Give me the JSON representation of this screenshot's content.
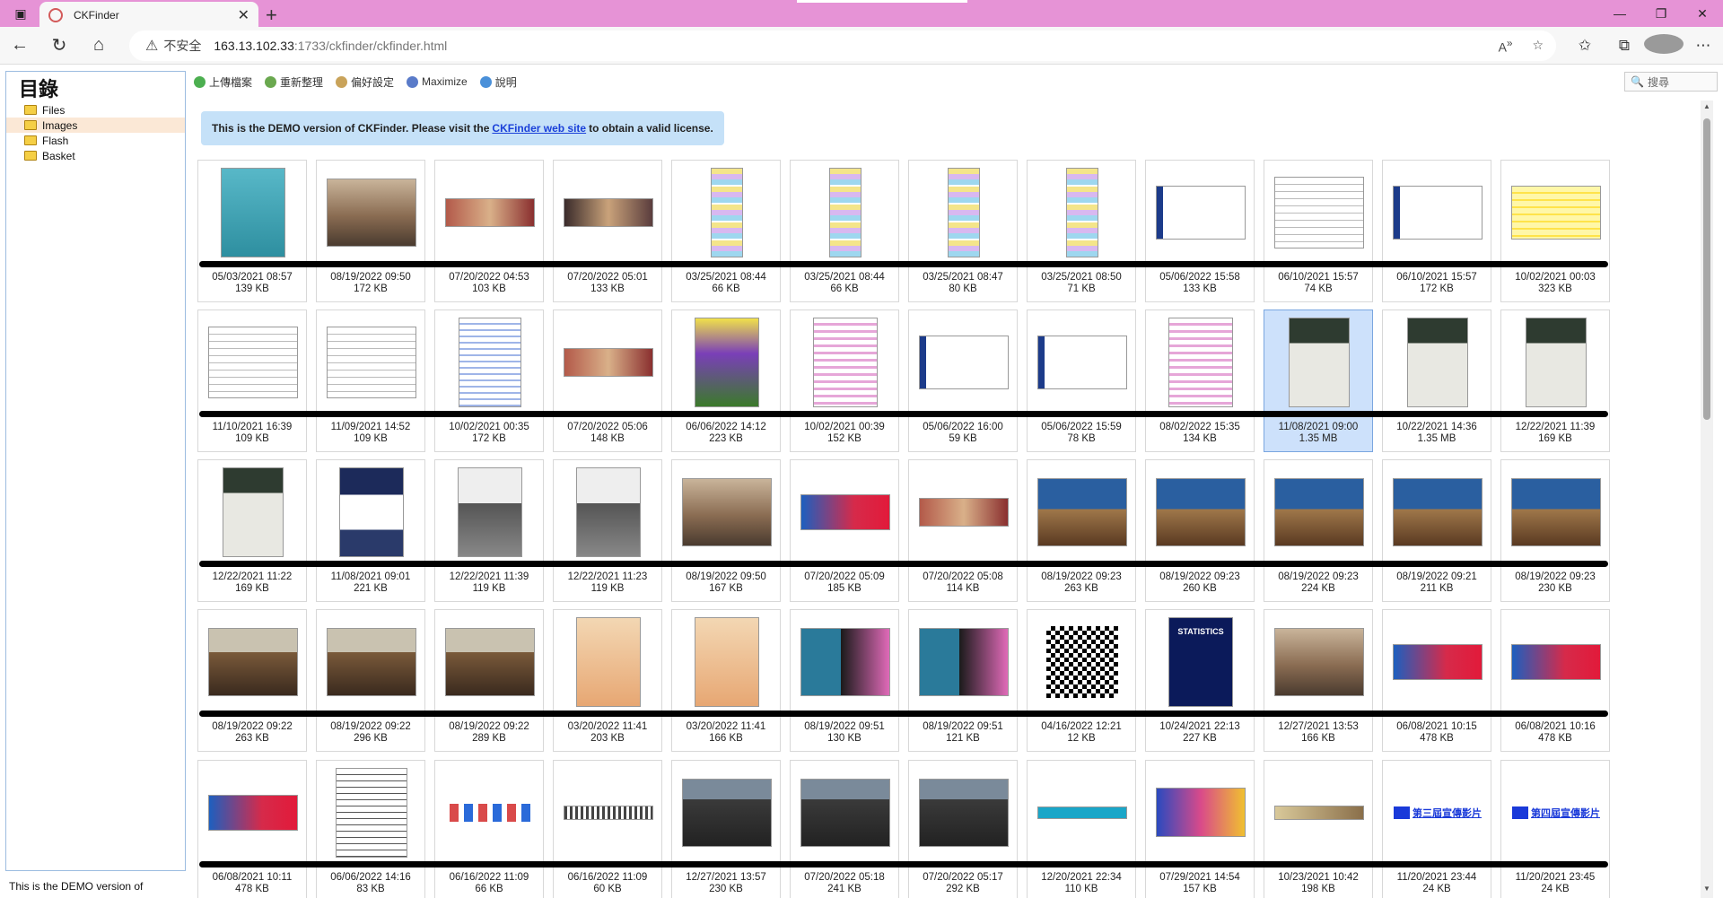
{
  "browser": {
    "tab_title": "CKFinder",
    "url_insecure_label": "不安全",
    "url_host": "163.13.102.33",
    "url_path": ":1733/ckfinder/ckfinder.html"
  },
  "left": {
    "title": "目錄",
    "folders": [
      "Files",
      "Images",
      "Flash",
      "Basket"
    ],
    "selected_folder": "Images",
    "footer": "This is the DEMO version of"
  },
  "toolbar": {
    "upload": "上傳檔案",
    "refresh": "重新整理",
    "settings": "偏好設定",
    "maximize": "Maximize",
    "help": "說明",
    "search_placeholder": "搜尋"
  },
  "notice": {
    "pre": "This is the DEMO version of CKFinder. Please visit the",
    "link": "CKFinder web site",
    "post": "to obtain a valid license."
  },
  "files": [
    {
      "date": "05/03/2021 08:57",
      "size": "139 KB",
      "thumb": "poster-teal"
    },
    {
      "date": "08/19/2022 09:50",
      "size": "172 KB",
      "thumb": "photo-group"
    },
    {
      "date": "07/20/2022 04:53",
      "size": "103 KB",
      "thumb": "photo-wide"
    },
    {
      "date": "07/20/2022 05:01",
      "size": "133 KB",
      "thumb": "photo-wide2"
    },
    {
      "date": "03/25/2021 08:44",
      "size": "66 KB",
      "thumb": "table-color"
    },
    {
      "date": "03/25/2021 08:44",
      "size": "66 KB",
      "thumb": "table-color"
    },
    {
      "date": "03/25/2021 08:47",
      "size": "80 KB",
      "thumb": "table-color"
    },
    {
      "date": "03/25/2021 08:50",
      "size": "71 KB",
      "thumb": "table-color"
    },
    {
      "date": "05/06/2022 15:58",
      "size": "133 KB",
      "thumb": "screen"
    },
    {
      "date": "06/10/2021 15:57",
      "size": "74 KB",
      "thumb": "table-plain"
    },
    {
      "date": "06/10/2021 15:57",
      "size": "172 KB",
      "thumb": "screen"
    },
    {
      "date": "10/02/2021 00:03",
      "size": "323 KB",
      "thumb": "table-yellow"
    },
    {
      "date": "11/10/2021 16:39",
      "size": "109 KB",
      "thumb": "table-plain"
    },
    {
      "date": "11/09/2021 14:52",
      "size": "109 KB",
      "thumb": "table-plain"
    },
    {
      "date": "10/02/2021 00:35",
      "size": "172 KB",
      "thumb": "doc-blue"
    },
    {
      "date": "07/20/2022 05:06",
      "size": "148 KB",
      "thumb": "photo-wide"
    },
    {
      "date": "06/06/2022 14:12",
      "size": "223 KB",
      "thumb": "poster-purple"
    },
    {
      "date": "10/02/2021 00:39",
      "size": "152 KB",
      "thumb": "doc-pink"
    },
    {
      "date": "05/06/2022 16:00",
      "size": "59 KB",
      "thumb": "screen"
    },
    {
      "date": "05/06/2022 15:59",
      "size": "78 KB",
      "thumb": "screen"
    },
    {
      "date": "08/02/2022 15:35",
      "size": "134 KB",
      "thumb": "doc-pink"
    },
    {
      "date": "11/08/2021 09:00",
      "size": "1.35 MB",
      "thumb": "poster-board",
      "selected": true
    },
    {
      "date": "10/22/2021 14:36",
      "size": "1.35 MB",
      "thumb": "poster-board"
    },
    {
      "date": "12/22/2021 11:39",
      "size": "169 KB",
      "thumb": "poster-board"
    },
    {
      "date": "12/22/2021 11:22",
      "size": "169 KB",
      "thumb": "poster-board"
    },
    {
      "date": "11/08/2021 09:01",
      "size": "221 KB",
      "thumb": "poster-navy"
    },
    {
      "date": "12/22/2021 11:39",
      "size": "119 KB",
      "thumb": "poster-grey"
    },
    {
      "date": "12/22/2021 11:23",
      "size": "119 KB",
      "thumb": "poster-grey"
    },
    {
      "date": "08/19/2022 09:50",
      "size": "167 KB",
      "thumb": "photo-group"
    },
    {
      "date": "07/20/2022 05:09",
      "size": "185 KB",
      "thumb": "banner-red"
    },
    {
      "date": "07/20/2022 05:08",
      "size": "114 KB",
      "thumb": "photo-wide"
    },
    {
      "date": "08/19/2022 09:23",
      "size": "263 KB",
      "thumb": "photo-room"
    },
    {
      "date": "08/19/2022 09:23",
      "size": "260 KB",
      "thumb": "photo-room"
    },
    {
      "date": "08/19/2022 09:23",
      "size": "224 KB",
      "thumb": "photo-room"
    },
    {
      "date": "08/19/2022 09:21",
      "size": "211 KB",
      "thumb": "photo-room"
    },
    {
      "date": "08/19/2022 09:23",
      "size": "230 KB",
      "thumb": "photo-room"
    },
    {
      "date": "08/19/2022 09:22",
      "size": "263 KB",
      "thumb": "photo-hall"
    },
    {
      "date": "08/19/2022 09:22",
      "size": "296 KB",
      "thumb": "photo-hall"
    },
    {
      "date": "08/19/2022 09:22",
      "size": "289 KB",
      "thumb": "photo-hall"
    },
    {
      "date": "03/20/2022 11:41",
      "size": "203 KB",
      "thumb": "doc-orange"
    },
    {
      "date": "03/20/2022 11:41",
      "size": "166 KB",
      "thumb": "doc-orange"
    },
    {
      "date": "08/19/2022 09:51",
      "size": "130 KB",
      "thumb": "photo-stage"
    },
    {
      "date": "08/19/2022 09:51",
      "size": "121 KB",
      "thumb": "photo-stage"
    },
    {
      "date": "04/16/2022 12:21",
      "size": "12 KB",
      "thumb": "qr"
    },
    {
      "date": "10/24/2021 22:13",
      "size": "227 KB",
      "thumb": "book-stat"
    },
    {
      "date": "12/27/2021 13:53",
      "size": "166 KB",
      "thumb": "photo-group"
    },
    {
      "date": "06/08/2021 10:15",
      "size": "478 KB",
      "thumb": "banner-red"
    },
    {
      "date": "06/08/2021 10:16",
      "size": "478 KB",
      "thumb": "banner-red"
    },
    {
      "date": "06/08/2021 10:11",
      "size": "478 KB",
      "thumb": "banner-red"
    },
    {
      "date": "06/06/2022 14:16",
      "size": "83 KB",
      "thumb": "doc-text"
    },
    {
      "date": "06/16/2022 11:09",
      "size": "66 KB",
      "thumb": "logos"
    },
    {
      "date": "06/16/2022 11:09",
      "size": "60 KB",
      "thumb": "doc-line"
    },
    {
      "date": "12/27/2021 13:57",
      "size": "230 KB",
      "thumb": "photo-crowd"
    },
    {
      "date": "07/20/2022 05:18",
      "size": "241 KB",
      "thumb": "photo-crowd"
    },
    {
      "date": "07/20/2022 05:17",
      "size": "292 KB",
      "thumb": "photo-crowd"
    },
    {
      "date": "12/20/2021 22:34",
      "size": "110 KB",
      "thumb": "banner-teal"
    },
    {
      "date": "07/29/2021 14:54",
      "size": "157 KB",
      "thumb": "poster-colorful"
    },
    {
      "date": "10/23/2021 10:42",
      "size": "198 KB",
      "thumb": "banner-slim"
    },
    {
      "date": "11/20/2021 23:44",
      "size": "24 KB",
      "thumb": "video-label-3"
    },
    {
      "date": "11/20/2021 23:45",
      "size": "24 KB",
      "thumb": "video-label-4"
    }
  ],
  "thumb_text": {
    "video_3": "第三屆宣傳影片",
    "video_4": "第四屆宣傳影片",
    "statistics": "STATISTICS"
  }
}
